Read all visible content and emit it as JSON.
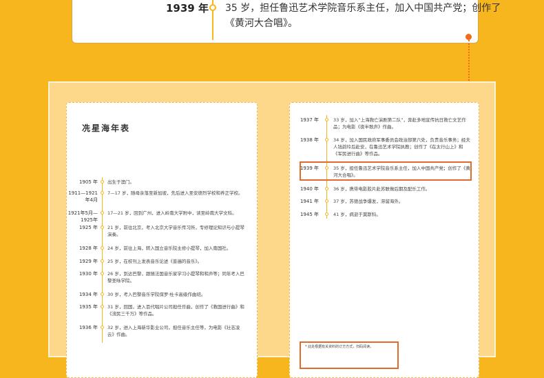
{
  "callout": {
    "year": "1939 年",
    "line1": "35 岁，担任鲁迅艺术学院音乐系主任，加入中国共产党；创作了",
    "line2": "《黄河大合唱》。"
  },
  "left_page": {
    "title": "冼星海年表",
    "entries": [
      {
        "year": "1905 年",
        "text": "出生于澳门。"
      },
      {
        "year": "1911—1921年4月",
        "text": "7—17 岁，随母亲落至新加坡，先后进入圣安德烈学校和养正学校。"
      },
      {
        "year": "1921年5月—1925年",
        "text": "17—21 岁，回到广州，进入岭南大学附中，读至岭南大学文科。"
      },
      {
        "year": "1925 年",
        "text": "21 岁，前往北京，考入北京大学音乐传习所，专修理论知识与小提琴演奏。"
      },
      {
        "year": "1928 年",
        "text": "24 岁，前往上海，转入国立音乐院主修小提琴，加入南国社。"
      },
      {
        "year": "1929 年",
        "text": "25 岁，在校刊上发表音乐论述《普遍的音乐》。"
      },
      {
        "year": "1930 年",
        "text": "26 岁，到达巴黎，跟随法国音乐家学习小提琴和和声等；同年考入巴黎圣咏学院。"
      },
      {
        "year": "1934 年",
        "text": "30 岁，考入巴黎音乐学院保罗·杜卡高级作曲班。"
      },
      {
        "year": "1935 年",
        "text": "31 岁，回国，进入百代唱片公司担任作曲，创作了《救国进行曲》和《流民三千万》等作品。"
      },
      {
        "year": "1936 年",
        "text": "32 岁，进入上海新华影业公司，担任音乐主任等，为电影《壮志凌云》作曲。"
      }
    ]
  },
  "right_page": {
    "entries": [
      {
        "year": "1937 年",
        "text": "33 岁，加入“上海救亡演剧第二队”，奔赴多地宣传抗日救亡文艺作品；为电影《夜半歌声》作曲。"
      },
      {
        "year": "1938 年",
        "text": "34 岁，加入国民政府军事委员会政治部第六处，负责音乐事务；经夫人钱韵玲后赴安，在鲁迅艺术学院执教；创作了《在太行山上》和《军民进行曲》等作品。"
      },
      {
        "year": "1939 年",
        "text": "35 岁，担任鲁迅艺术学院音乐系主任，加入中国共产党；创作了《黄河大合唱》。"
      },
      {
        "year": "1940 年",
        "text": "36 岁，携带电影胶片赴苏联做后期及配乐工作。"
      },
      {
        "year": "1941 年",
        "text": "37 岁，苏德战争爆发，滞留海外。"
      },
      {
        "year": "1945 年",
        "text": "41 岁，病逝于莫斯科。"
      }
    ],
    "note": "* 此处根据有关资料的订方方式，扫码阅读。"
  }
}
